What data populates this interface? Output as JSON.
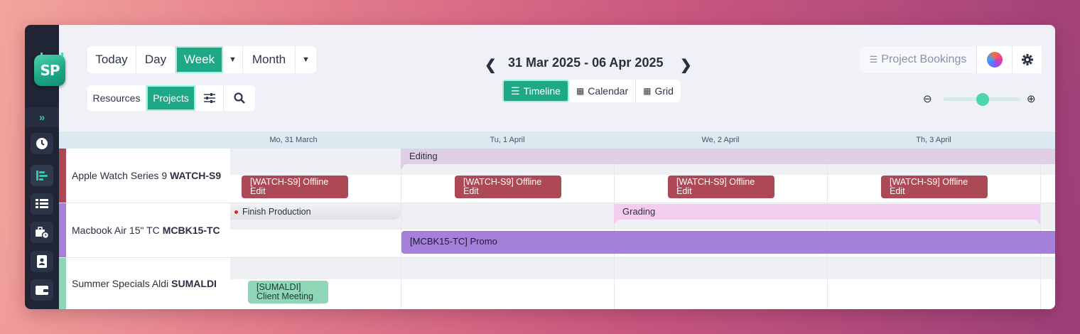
{
  "sidebar": {
    "logo": "SP",
    "items": [
      {
        "icon": "expand-icon",
        "glyph": "»"
      },
      {
        "icon": "clock-icon",
        "glyph": "🕒"
      },
      {
        "icon": "timeline-icon",
        "glyph": "☰"
      },
      {
        "icon": "list-icon",
        "glyph": "▤"
      },
      {
        "icon": "briefcase-clock-icon",
        "glyph": "▣"
      },
      {
        "icon": "contact-icon",
        "glyph": "▮"
      },
      {
        "icon": "wallet-icon",
        "glyph": "▬"
      }
    ]
  },
  "toolbar": {
    "today": "Today",
    "day": "Day",
    "week": "Week",
    "month": "Month",
    "resources": "Resources",
    "projects": "Projects",
    "prev": "❮",
    "next": "❯",
    "range": "31 Mar 2025 - 06 Apr 2025",
    "timeline": "Timeline",
    "calendar": "Calendar",
    "grid": "Grid",
    "project_bookings": "Project Bookings"
  },
  "days": [
    "Mo, 31 March",
    "Tu, 1 April",
    "We, 2 April",
    "Th, 3 April"
  ],
  "rows": [
    {
      "name": "Apple Watch Series 9",
      "code": "WATCH-S9",
      "color": "#ad4956"
    },
    {
      "name": "Macbook Air 15\" TC",
      "code": "MCBK15-TC",
      "color": "#a580d9"
    },
    {
      "name": "Summer Specials Aldi",
      "code": "SUMALDI",
      "color": "#8ed6b6"
    }
  ],
  "events": {
    "editing": "Editing",
    "offline_edit": "[WATCH-S9] Offline Edit",
    "finish_production": "Finish Production",
    "grading": "Grading",
    "promo": "[MCBK15-TC] Promo",
    "client_meeting": "[SUMALDI] Client Meeting"
  },
  "zoom": {
    "level": 0.5
  },
  "colors": {
    "accent": "#1ea887",
    "sidebar": "#1f2535"
  }
}
